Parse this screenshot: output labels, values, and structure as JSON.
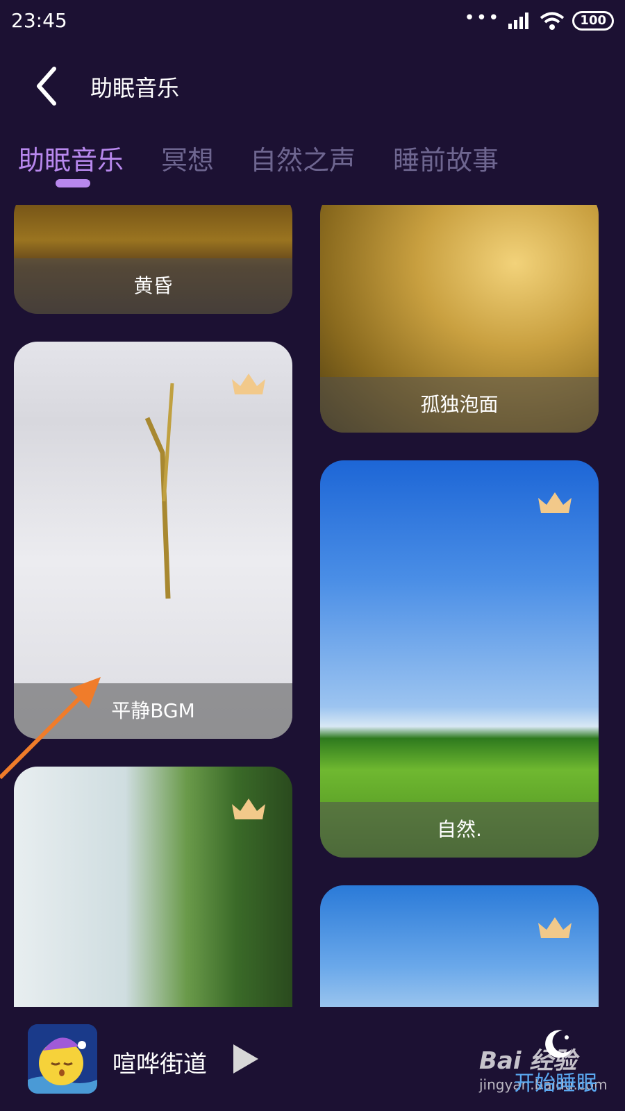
{
  "status": {
    "time": "23:45",
    "battery": "100"
  },
  "header": {
    "title": "助眠音乐"
  },
  "tabs": [
    {
      "label": "助眠音乐",
      "active": true
    },
    {
      "label": "冥想",
      "active": false
    },
    {
      "label": "自然之声",
      "active": false
    },
    {
      "label": "睡前故事",
      "active": false
    }
  ],
  "cards": [
    {
      "label": "黄昏",
      "vip": false
    },
    {
      "label": "孤独泡面",
      "vip": false
    },
    {
      "label": "平静BGM",
      "vip": true
    },
    {
      "label": "自然.",
      "vip": true
    },
    {
      "label": "",
      "vip": true
    },
    {
      "label": "",
      "vip": true
    }
  ],
  "player": {
    "track": "喧哗街道",
    "sleep_button": "开始睡眠"
  },
  "watermark": {
    "logo": "Bai 经验",
    "url": "jingyan.baidu.com"
  },
  "colors": {
    "background": "#1c1133",
    "accent": "#b888ee",
    "tab_inactive": "#6e6690",
    "crown": "#f2c98a",
    "sleep_button": "#5aa8f0"
  },
  "icons": [
    "back-arrow-icon",
    "signal-icon",
    "wifi-icon",
    "crown-icon",
    "play-icon",
    "moon-icon"
  ]
}
